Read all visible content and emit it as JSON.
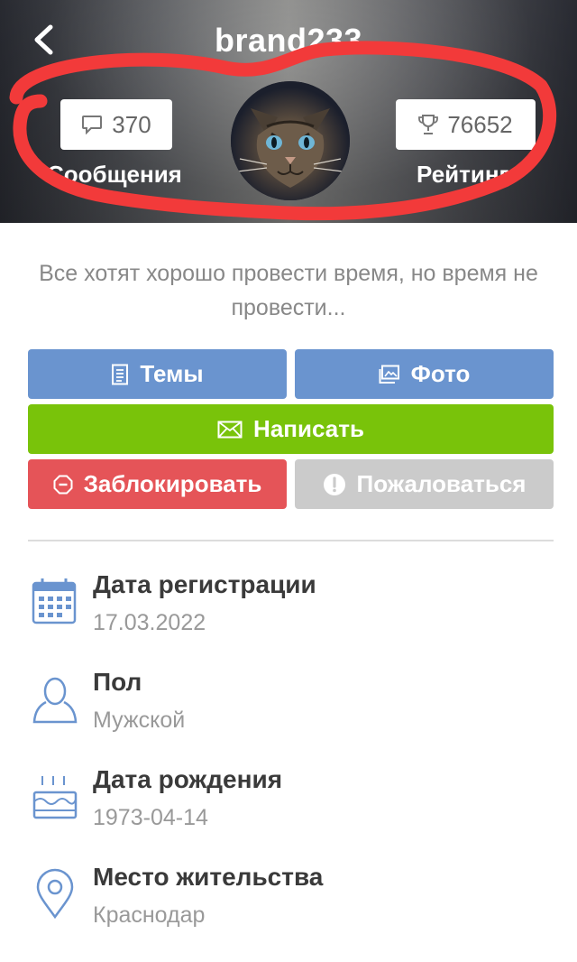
{
  "header": {
    "title": "brand233",
    "back_icon": "chevron-left-icon",
    "messages": {
      "count": "370",
      "label": "Сообщения",
      "icon": "speech-bubble-icon"
    },
    "rating": {
      "count": "76652",
      "label": "Рейтинг",
      "icon": "trophy-icon"
    },
    "avatar": "cat-avatar"
  },
  "status_text": "Все хотят хорошо провести время, но время не провести...",
  "buttons": {
    "topics": {
      "label": "Темы",
      "icon": "document-icon",
      "color": "#6a94cf"
    },
    "photo": {
      "label": "Фото",
      "icon": "photo-icon",
      "color": "#6a94cf"
    },
    "write": {
      "label": "Написать",
      "icon": "envelope-icon",
      "color": "#79c30a"
    },
    "block": {
      "label": "Заблокировать",
      "icon": "stop-octagon-icon",
      "color": "#e55458"
    },
    "report": {
      "label": "Пожаловаться",
      "icon": "exclamation-circle-icon",
      "color": "#cbcbcb"
    }
  },
  "info": [
    {
      "label": "Дата регистрации",
      "value": "17.03.2022",
      "icon": "calendar-icon"
    },
    {
      "label": "Пол",
      "value": "Мужской",
      "icon": "person-icon"
    },
    {
      "label": "Дата рождения",
      "value": "1973-04-14",
      "icon": "cake-icon"
    },
    {
      "label": "Место жительства",
      "value": "Краснодар",
      "icon": "location-pin-icon"
    }
  ],
  "annotation_color": "#f23a3a",
  "icon_color": "#6a94cf"
}
